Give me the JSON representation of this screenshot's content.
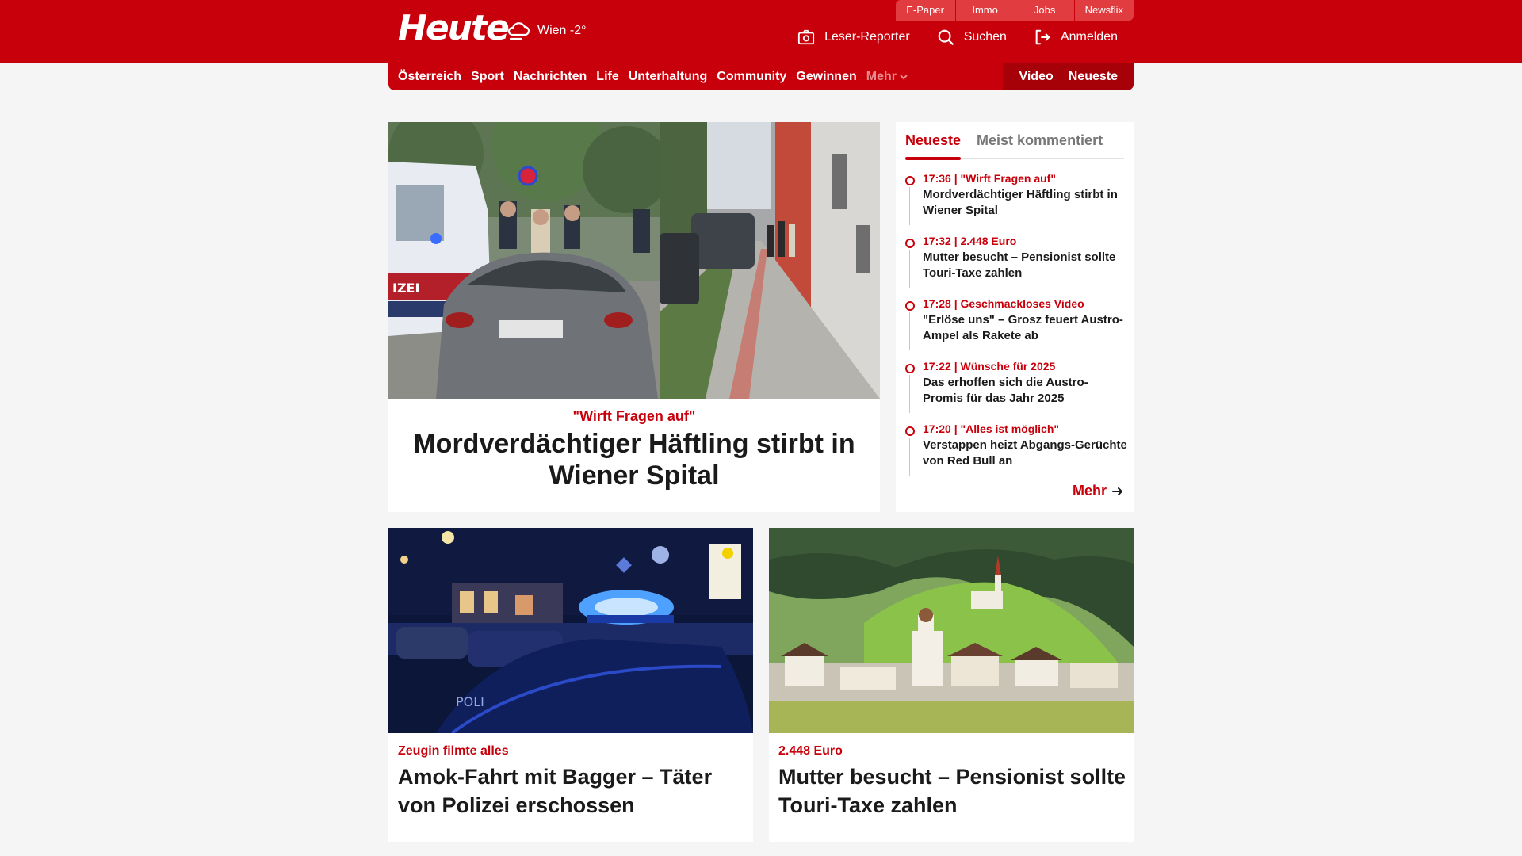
{
  "header": {
    "logo": "Heute",
    "weather": "Wien -2°",
    "utility_links": [
      "E-Paper",
      "Immo",
      "Jobs",
      "Newsflix"
    ],
    "actions": {
      "reporter": "Leser-Reporter",
      "search": "Suchen",
      "login": "Anmelden"
    }
  },
  "nav": {
    "items": [
      "Österreich",
      "Sport",
      "Nachrichten",
      "Life",
      "Unterhaltung",
      "Community",
      "Gewinnen"
    ],
    "more": "Mehr",
    "right": [
      "Video",
      "Neueste"
    ]
  },
  "hero": {
    "kicker": "\"Wirft Fragen auf\"",
    "title": "Mordverdächtiger Häftling stirbt in Wiener Spital"
  },
  "sidebar": {
    "tabs": [
      "Neueste",
      "Meist kommentiert"
    ],
    "items": [
      {
        "meta": "17:36 | \"Wirft Fragen auf\"",
        "title": "Mordverdächtiger Häftling stirbt in Wiener Spital"
      },
      {
        "meta": "17:32 | 2.448 Euro",
        "title": "Mutter besucht – Pensionist sollte Touri-Taxe zahlen"
      },
      {
        "meta": "17:28 | Geschmackloses Video",
        "title": "\"Erlöse uns\" – Grosz feuert Austro-Ampel als Rakete ab"
      },
      {
        "meta": "17:22 | Wünsche für 2025",
        "title": "Das erhoffen sich die Austro-Promis für das Jahr 2025"
      },
      {
        "meta": "17:20 | \"Alles ist möglich\"",
        "title": "Verstappen heizt Abgangs-Gerüchte von Red Bull an"
      }
    ],
    "more": "Mehr"
  },
  "cards": [
    {
      "kicker": "Zeugin filmte alles",
      "title": "Amok-Fahrt mit Bagger – Täter von Polizei erschossen"
    },
    {
      "kicker": "2.448 Euro",
      "title": "Mutter besucht – Pensionist sollte Touri-Taxe zahlen"
    }
  ],
  "colors": {
    "brand_red": "#c8000b",
    "utility_red": "#e13c3f",
    "background": "#f5f5f5"
  }
}
